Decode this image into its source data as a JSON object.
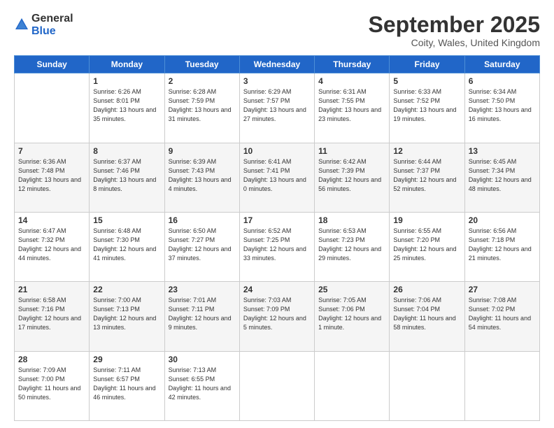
{
  "header": {
    "logo_general": "General",
    "logo_blue": "Blue",
    "month_title": "September 2025",
    "location": "Coity, Wales, United Kingdom"
  },
  "weekdays": [
    "Sunday",
    "Monday",
    "Tuesday",
    "Wednesday",
    "Thursday",
    "Friday",
    "Saturday"
  ],
  "weeks": [
    [
      {
        "day": "",
        "sunrise": "",
        "sunset": "",
        "daylight": ""
      },
      {
        "day": "1",
        "sunrise": "Sunrise: 6:26 AM",
        "sunset": "Sunset: 8:01 PM",
        "daylight": "Daylight: 13 hours and 35 minutes."
      },
      {
        "day": "2",
        "sunrise": "Sunrise: 6:28 AM",
        "sunset": "Sunset: 7:59 PM",
        "daylight": "Daylight: 13 hours and 31 minutes."
      },
      {
        "day": "3",
        "sunrise": "Sunrise: 6:29 AM",
        "sunset": "Sunset: 7:57 PM",
        "daylight": "Daylight: 13 hours and 27 minutes."
      },
      {
        "day": "4",
        "sunrise": "Sunrise: 6:31 AM",
        "sunset": "Sunset: 7:55 PM",
        "daylight": "Daylight: 13 hours and 23 minutes."
      },
      {
        "day": "5",
        "sunrise": "Sunrise: 6:33 AM",
        "sunset": "Sunset: 7:52 PM",
        "daylight": "Daylight: 13 hours and 19 minutes."
      },
      {
        "day": "6",
        "sunrise": "Sunrise: 6:34 AM",
        "sunset": "Sunset: 7:50 PM",
        "daylight": "Daylight: 13 hours and 16 minutes."
      }
    ],
    [
      {
        "day": "7",
        "sunrise": "Sunrise: 6:36 AM",
        "sunset": "Sunset: 7:48 PM",
        "daylight": "Daylight: 13 hours and 12 minutes."
      },
      {
        "day": "8",
        "sunrise": "Sunrise: 6:37 AM",
        "sunset": "Sunset: 7:46 PM",
        "daylight": "Daylight: 13 hours and 8 minutes."
      },
      {
        "day": "9",
        "sunrise": "Sunrise: 6:39 AM",
        "sunset": "Sunset: 7:43 PM",
        "daylight": "Daylight: 13 hours and 4 minutes."
      },
      {
        "day": "10",
        "sunrise": "Sunrise: 6:41 AM",
        "sunset": "Sunset: 7:41 PM",
        "daylight": "Daylight: 13 hours and 0 minutes."
      },
      {
        "day": "11",
        "sunrise": "Sunrise: 6:42 AM",
        "sunset": "Sunset: 7:39 PM",
        "daylight": "Daylight: 12 hours and 56 minutes."
      },
      {
        "day": "12",
        "sunrise": "Sunrise: 6:44 AM",
        "sunset": "Sunset: 7:37 PM",
        "daylight": "Daylight: 12 hours and 52 minutes."
      },
      {
        "day": "13",
        "sunrise": "Sunrise: 6:45 AM",
        "sunset": "Sunset: 7:34 PM",
        "daylight": "Daylight: 12 hours and 48 minutes."
      }
    ],
    [
      {
        "day": "14",
        "sunrise": "Sunrise: 6:47 AM",
        "sunset": "Sunset: 7:32 PM",
        "daylight": "Daylight: 12 hours and 44 minutes."
      },
      {
        "day": "15",
        "sunrise": "Sunrise: 6:48 AM",
        "sunset": "Sunset: 7:30 PM",
        "daylight": "Daylight: 12 hours and 41 minutes."
      },
      {
        "day": "16",
        "sunrise": "Sunrise: 6:50 AM",
        "sunset": "Sunset: 7:27 PM",
        "daylight": "Daylight: 12 hours and 37 minutes."
      },
      {
        "day": "17",
        "sunrise": "Sunrise: 6:52 AM",
        "sunset": "Sunset: 7:25 PM",
        "daylight": "Daylight: 12 hours and 33 minutes."
      },
      {
        "day": "18",
        "sunrise": "Sunrise: 6:53 AM",
        "sunset": "Sunset: 7:23 PM",
        "daylight": "Daylight: 12 hours and 29 minutes."
      },
      {
        "day": "19",
        "sunrise": "Sunrise: 6:55 AM",
        "sunset": "Sunset: 7:20 PM",
        "daylight": "Daylight: 12 hours and 25 minutes."
      },
      {
        "day": "20",
        "sunrise": "Sunrise: 6:56 AM",
        "sunset": "Sunset: 7:18 PM",
        "daylight": "Daylight: 12 hours and 21 minutes."
      }
    ],
    [
      {
        "day": "21",
        "sunrise": "Sunrise: 6:58 AM",
        "sunset": "Sunset: 7:16 PM",
        "daylight": "Daylight: 12 hours and 17 minutes."
      },
      {
        "day": "22",
        "sunrise": "Sunrise: 7:00 AM",
        "sunset": "Sunset: 7:13 PM",
        "daylight": "Daylight: 12 hours and 13 minutes."
      },
      {
        "day": "23",
        "sunrise": "Sunrise: 7:01 AM",
        "sunset": "Sunset: 7:11 PM",
        "daylight": "Daylight: 12 hours and 9 minutes."
      },
      {
        "day": "24",
        "sunrise": "Sunrise: 7:03 AM",
        "sunset": "Sunset: 7:09 PM",
        "daylight": "Daylight: 12 hours and 5 minutes."
      },
      {
        "day": "25",
        "sunrise": "Sunrise: 7:05 AM",
        "sunset": "Sunset: 7:06 PM",
        "daylight": "Daylight: 12 hours and 1 minute."
      },
      {
        "day": "26",
        "sunrise": "Sunrise: 7:06 AM",
        "sunset": "Sunset: 7:04 PM",
        "daylight": "Daylight: 11 hours and 58 minutes."
      },
      {
        "day": "27",
        "sunrise": "Sunrise: 7:08 AM",
        "sunset": "Sunset: 7:02 PM",
        "daylight": "Daylight: 11 hours and 54 minutes."
      }
    ],
    [
      {
        "day": "28",
        "sunrise": "Sunrise: 7:09 AM",
        "sunset": "Sunset: 7:00 PM",
        "daylight": "Daylight: 11 hours and 50 minutes."
      },
      {
        "day": "29",
        "sunrise": "Sunrise: 7:11 AM",
        "sunset": "Sunset: 6:57 PM",
        "daylight": "Daylight: 11 hours and 46 minutes."
      },
      {
        "day": "30",
        "sunrise": "Sunrise: 7:13 AM",
        "sunset": "Sunset: 6:55 PM",
        "daylight": "Daylight: 11 hours and 42 minutes."
      },
      {
        "day": "",
        "sunrise": "",
        "sunset": "",
        "daylight": ""
      },
      {
        "day": "",
        "sunrise": "",
        "sunset": "",
        "daylight": ""
      },
      {
        "day": "",
        "sunrise": "",
        "sunset": "",
        "daylight": ""
      },
      {
        "day": "",
        "sunrise": "",
        "sunset": "",
        "daylight": ""
      }
    ]
  ]
}
